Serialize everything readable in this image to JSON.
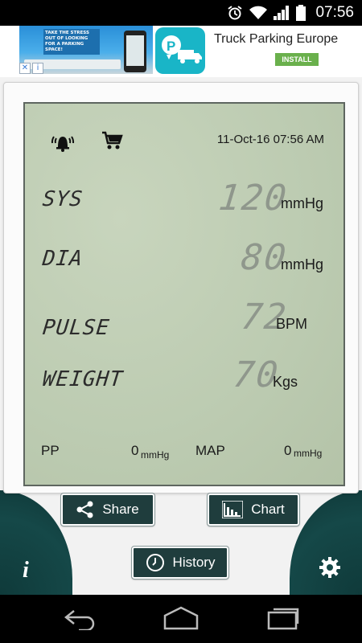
{
  "status_bar": {
    "time": "07:56"
  },
  "ad": {
    "image_text": "TAKE THE STRESS OUT OF LOOKING FOR A PARKING SPACE!",
    "title": "Truck Parking Europe",
    "install_label": "INSTALL"
  },
  "display": {
    "datetime": "11-Oct-16 07:56 AM",
    "sys": {
      "label": "SYS",
      "value": "120",
      "unit": "mmHg"
    },
    "dia": {
      "label": "DIA",
      "value": "80",
      "unit": "mmHg"
    },
    "pulse": {
      "label": "PULSE",
      "value": "72",
      "unit": "BPM"
    },
    "weight": {
      "label": "WEIGHT",
      "value": "70",
      "unit": "Kgs"
    },
    "pp": {
      "label": "PP",
      "value": "0",
      "unit": "mmHg"
    },
    "map": {
      "label": "MAP",
      "value": "0",
      "unit": "mmHg"
    }
  },
  "buttons": {
    "share": "Share",
    "chart": "Chart",
    "history": "History",
    "info": "i"
  },
  "colors": {
    "lcd_bg": "#bccbb1",
    "button_bg": "#1f3d3d",
    "accent_teal": "#154848"
  }
}
